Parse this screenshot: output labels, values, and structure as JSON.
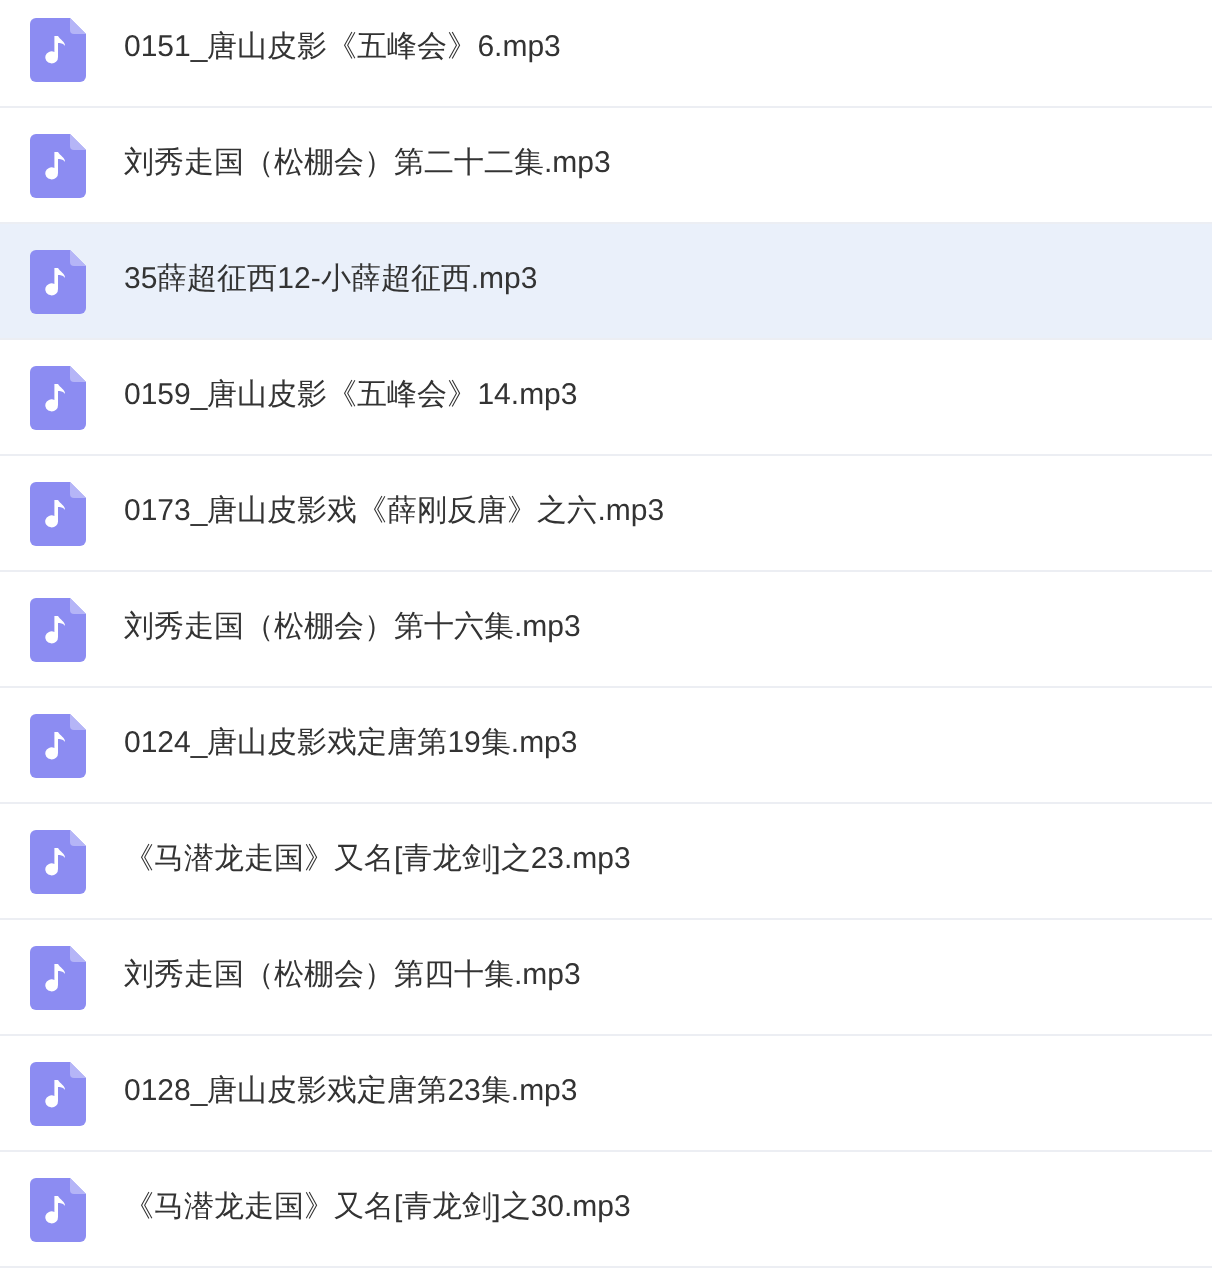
{
  "files": [
    {
      "name": "0151_唐山皮影《五峰会》6.mp3",
      "selected": false
    },
    {
      "name": "刘秀走国（松棚会）第二十二集.mp3",
      "selected": false
    },
    {
      "name": "35薛超征西12-小薛超征西.mp3",
      "selected": true
    },
    {
      "name": "0159_唐山皮影《五峰会》14.mp3",
      "selected": false
    },
    {
      "name": "0173_唐山皮影戏《薛刚反唐》之六.mp3",
      "selected": false
    },
    {
      "name": "刘秀走国（松棚会）第十六集.mp3",
      "selected": false
    },
    {
      "name": "0124_唐山皮影戏定唐第19集.mp3",
      "selected": false
    },
    {
      "name": "《马潜龙走国》又名[青龙剑]之23.mp3",
      "selected": false
    },
    {
      "name": "刘秀走国（松棚会）第四十集.mp3",
      "selected": false
    },
    {
      "name": "0128_唐山皮影戏定唐第23集.mp3",
      "selected": false
    },
    {
      "name": "《马潜龙走国》又名[青龙剑]之30.mp3",
      "selected": false
    }
  ]
}
